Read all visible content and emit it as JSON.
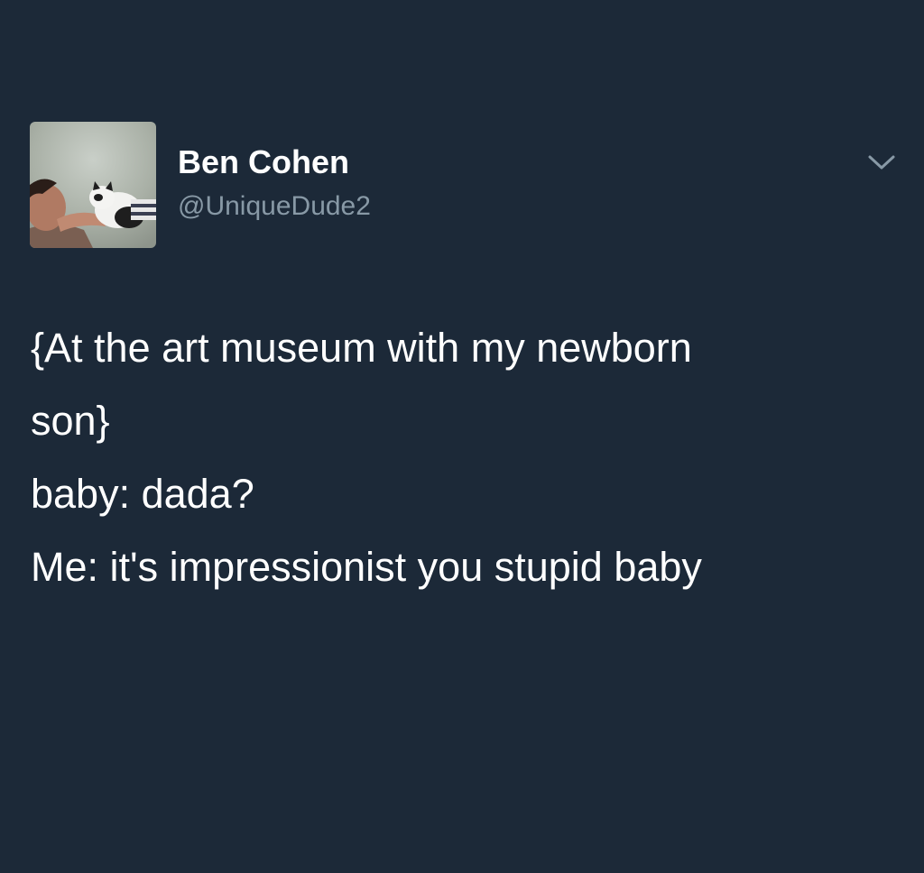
{
  "tweet": {
    "author": {
      "name": "Ben Cohen",
      "handle": "@UniqueDude2",
      "avatar": "profile-photo-man-with-cat"
    },
    "menu_icon": "chevron-down-icon",
    "text_lines": [
      "{At the art museum with my newborn",
      "son}",
      "baby: dada?",
      "Me: it's impressionist you stupid baby"
    ]
  },
  "colors": {
    "background": "#1c2938",
    "name_text": "#ffffff",
    "handle_text": "#8899a6",
    "body_text": "#ffffff",
    "chevron": "#8899a6"
  }
}
